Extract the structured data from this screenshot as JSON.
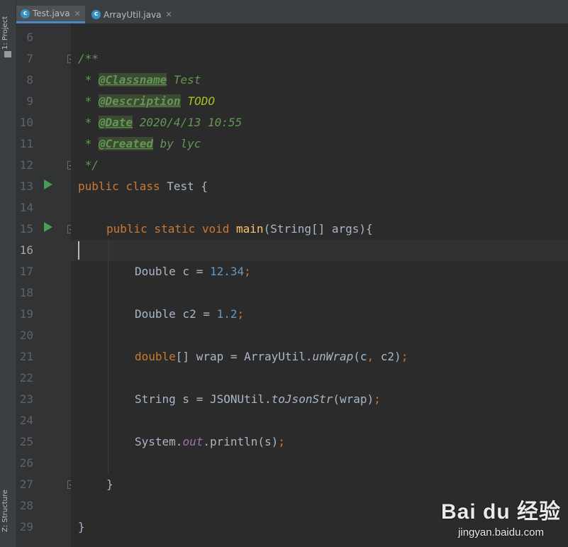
{
  "sidebar": {
    "project_label": "1: Project",
    "structure_label": "Z: Structure"
  },
  "tabs": [
    {
      "icon": "c",
      "label": "Test.java",
      "close": "✕",
      "active": true
    },
    {
      "icon": "c",
      "label": "ArrayUtil.java",
      "close": "✕",
      "active": false
    }
  ],
  "line_numbers": [
    "6",
    "7",
    "8",
    "9",
    "10",
    "11",
    "12",
    "13",
    "14",
    "15",
    "16",
    "17",
    "18",
    "19",
    "20",
    "21",
    "22",
    "23",
    "24",
    "25",
    "26",
    "27",
    "28",
    "29"
  ],
  "code": {
    "l7": "/**",
    "l8_star": " * ",
    "l8_tag": "@Classname",
    "l8_text": " Test",
    "l9_star": " * ",
    "l9_tag": "@Description",
    "l9_text": "TODO",
    "l10_star": " * ",
    "l10_tag": "@Date",
    "l10_text": " 2020/4/13 10:55",
    "l11_star": " * ",
    "l11_tag": "@Created",
    "l11_text": " by lyc",
    "l12": " */",
    "l13_kw": "public class",
    "l13_rest": " Test {",
    "l15_kw": "public static void",
    "l15_fn": "main",
    "l15_rest": "(String[] args){",
    "l17_a": "Double c = ",
    "l17_num": "12.34",
    "l17_semi": ";",
    "l19_a": "Double c2 = ",
    "l19_num": "1.2",
    "l19_semi": ";",
    "l21_kw": "double",
    "l21_a": "[] wrap = ArrayUtil.",
    "l21_it": "unWrap",
    "l21_b": "(c",
    "l21_comma": ",",
    "l21_c": " c2)",
    "l21_semi": ";",
    "l23_a": "String s = JSONUtil.",
    "l23_it": "toJsonStr",
    "l23_b": "(wrap)",
    "l23_semi": ";",
    "l25_a": "System.",
    "l25_fld": "out",
    "l25_b": ".println(s)",
    "l25_semi": ";",
    "l27": "}",
    "l29": "}"
  },
  "watermark": {
    "logo": "Bai du 经验",
    "url": "jingyan.baidu.com"
  },
  "colors": {
    "keyword": "#cc7832",
    "number": "#6897bb",
    "function": "#ffc66d",
    "doc": "#629755",
    "run": "#499c54"
  }
}
